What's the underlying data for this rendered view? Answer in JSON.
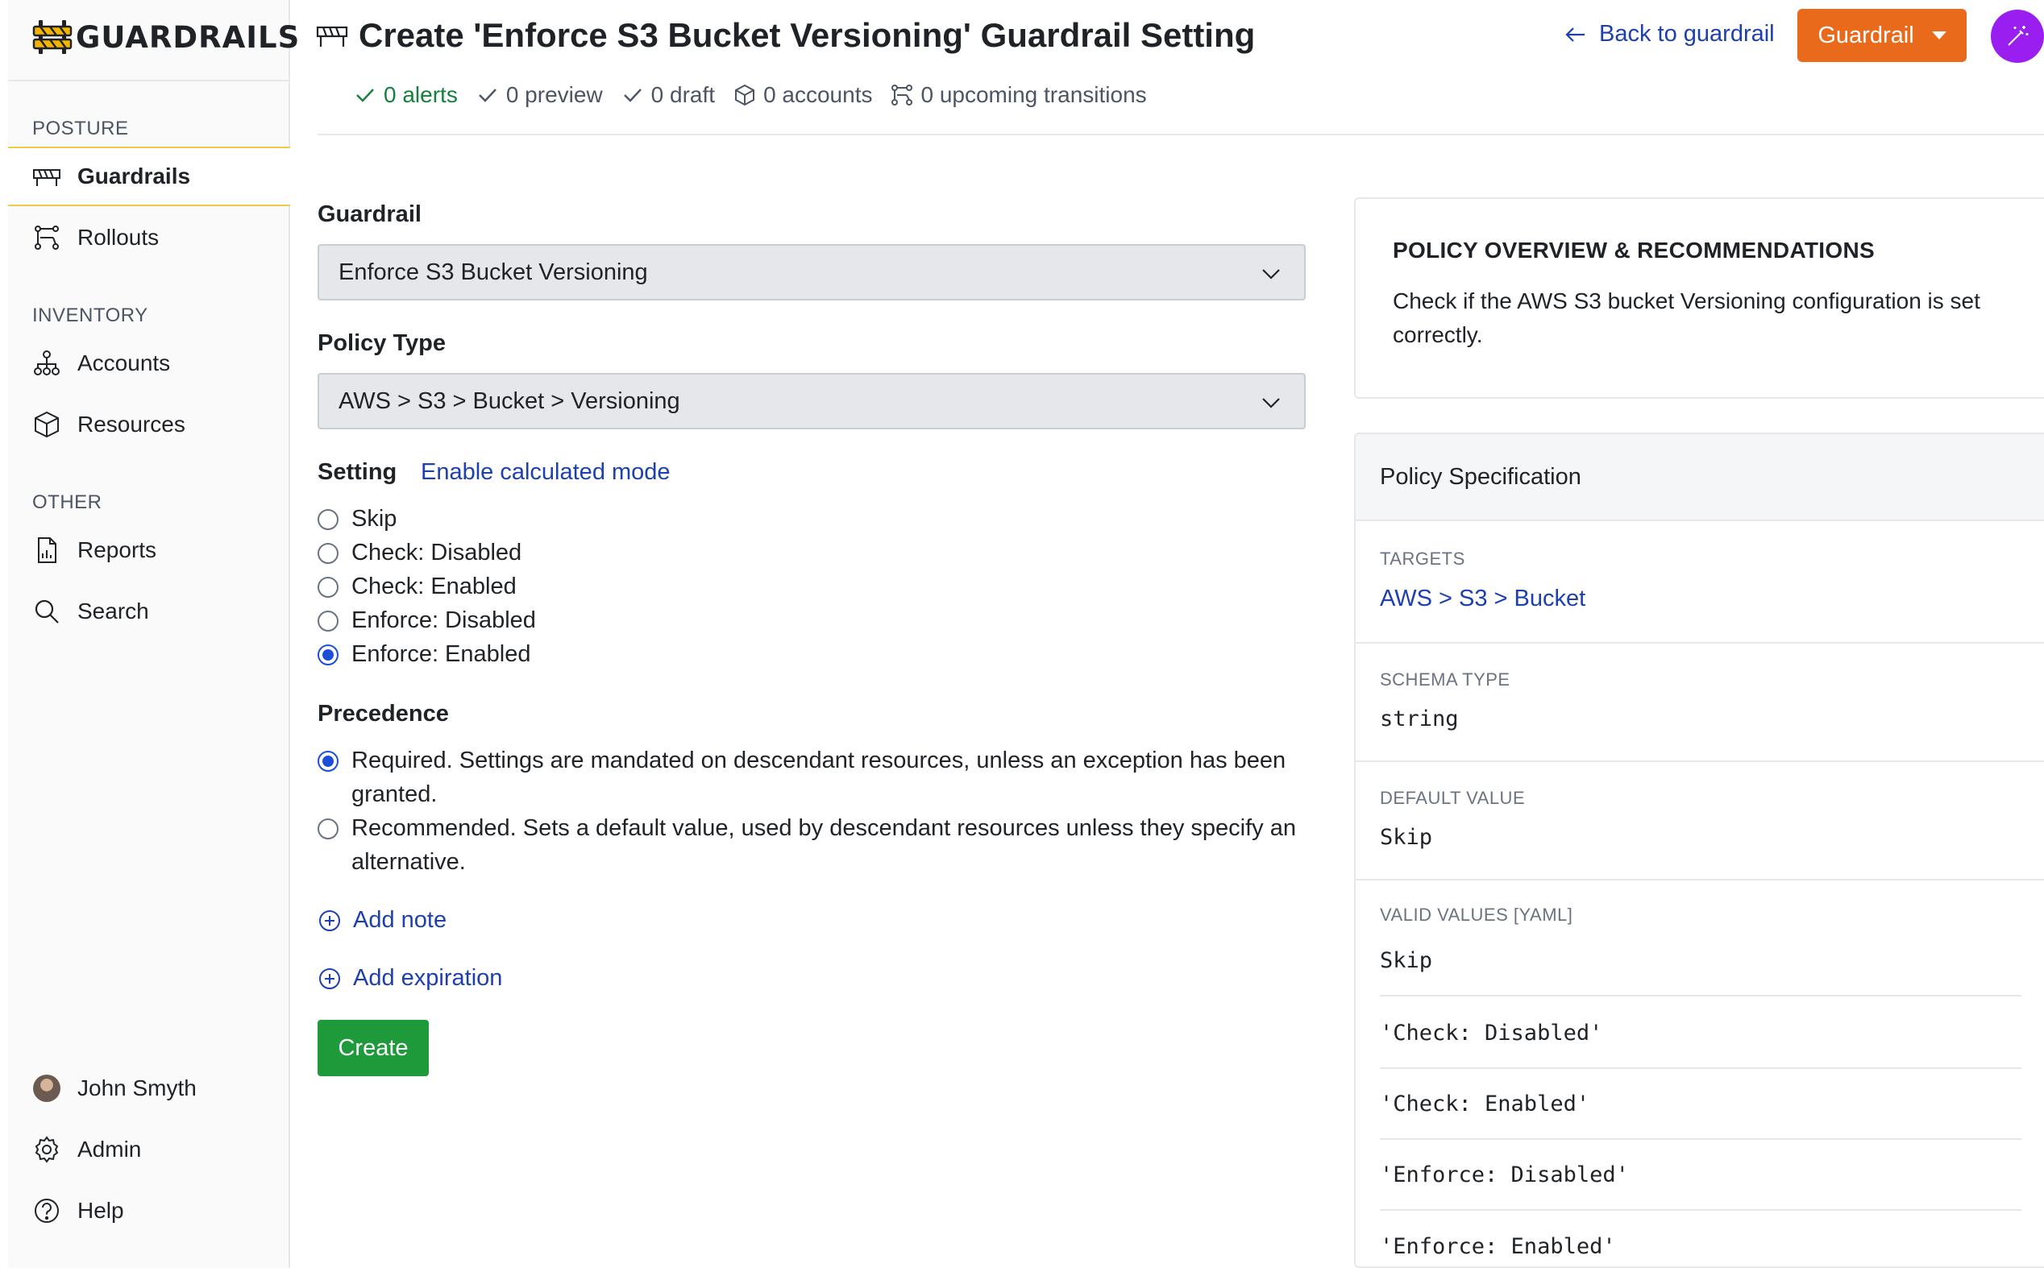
{
  "app": {
    "logo_text": "GUARDRAILS"
  },
  "sidebar": {
    "sections": [
      {
        "title": "POSTURE"
      },
      {
        "title": "INVENTORY"
      },
      {
        "title": "OTHER"
      }
    ],
    "items": [
      {
        "label": "Guardrails",
        "icon": "barrier-icon",
        "active": true
      },
      {
        "label": "Rollouts",
        "icon": "rollout-icon"
      },
      {
        "label": "Accounts",
        "icon": "hierarchy-icon"
      },
      {
        "label": "Resources",
        "icon": "cube-icon"
      },
      {
        "label": "Reports",
        "icon": "report-icon"
      },
      {
        "label": "Search",
        "icon": "search-icon"
      }
    ],
    "footer": [
      {
        "label": "John Smyth",
        "icon": "avatar"
      },
      {
        "label": "Admin",
        "icon": "gear-icon"
      },
      {
        "label": "Help",
        "icon": "help-icon"
      }
    ]
  },
  "header": {
    "title": "Create 'Enforce S3 Bucket Versioning' Guardrail Setting",
    "back_label": "Back to guardrail",
    "guardrail_button": "Guardrail",
    "status": {
      "alerts": "0 alerts",
      "preview": "0 preview",
      "draft": "0 draft",
      "accounts": "0 accounts",
      "transitions": "0 upcoming transitions"
    }
  },
  "form": {
    "guardrail_label": "Guardrail",
    "guardrail_value": "Enforce S3 Bucket Versioning",
    "policy_type_label": "Policy Type",
    "policy_type_value": "AWS > S3 > Bucket > Versioning",
    "setting_label": "Setting",
    "calculated_mode_link": "Enable calculated mode",
    "setting_options": [
      {
        "label": "Skip",
        "checked": false
      },
      {
        "label": "Check: Disabled",
        "checked": false
      },
      {
        "label": "Check: Enabled",
        "checked": false
      },
      {
        "label": "Enforce: Disabled",
        "checked": false
      },
      {
        "label": "Enforce: Enabled",
        "checked": true
      }
    ],
    "precedence_label": "Precedence",
    "precedence_options": [
      {
        "label": "Required. Settings are mandated on descendant resources, unless an exception has been granted.",
        "checked": true
      },
      {
        "label": "Recommended. Sets a default value, used by descendant resources unless they specify an alternative.",
        "checked": false
      }
    ],
    "add_note": "Add note",
    "add_expiration": "Add expiration",
    "create_button": "Create"
  },
  "overview": {
    "title": "POLICY OVERVIEW & RECOMMENDATIONS",
    "description": "Check if the AWS S3 bucket Versioning configuration is set correctly."
  },
  "spec": {
    "title": "Policy Specification",
    "targets_label": "TARGETS",
    "targets_value": "AWS > S3 > Bucket",
    "schema_type_label": "SCHEMA TYPE",
    "schema_type_value": "string",
    "default_value_label": "DEFAULT VALUE",
    "default_value": "Skip",
    "valid_values_label": "VALID VALUES [YAML]",
    "valid_values": [
      "Skip",
      "'Check: Disabled'",
      "'Check: Enabled'",
      "'Enforce: Disabled'",
      "'Enforce: Enabled'"
    ]
  },
  "colors": {
    "accent_orange": "#ea6a1c",
    "accent_purple": "#9b1ef0",
    "link_blue": "#1e40af",
    "create_green": "#1f9a3a",
    "ok_green": "#15803d",
    "active_border": "#f2c94c"
  }
}
